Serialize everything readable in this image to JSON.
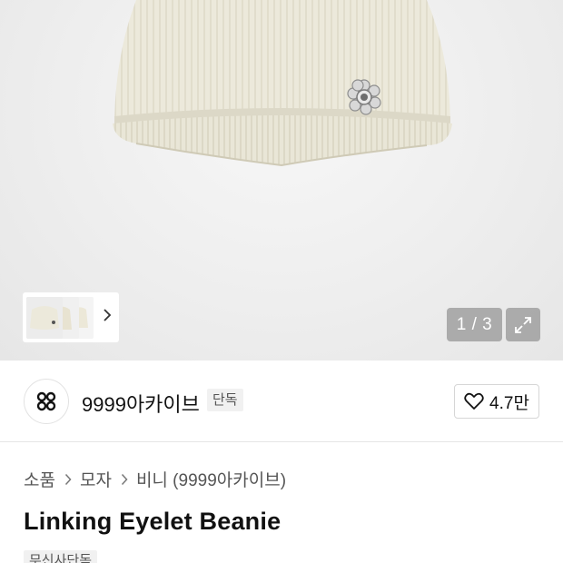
{
  "gallery": {
    "counter": "1 / 3"
  },
  "brand": {
    "name": "9999아카이브",
    "badge": "단독"
  },
  "like": {
    "count": "4.7만"
  },
  "breadcrumb": {
    "items": [
      "소품",
      "모자",
      "비니 (9999아카이브)"
    ]
  },
  "product": {
    "title": "Linking Eyelet Beanie",
    "tag": "무신사단독"
  },
  "colors": {
    "beanie": "#ece9db",
    "counter_bg": "#9a9a9a"
  },
  "icons": {
    "thumb_next": "chevron-right-icon",
    "expand": "expand-icon",
    "like": "heart-icon",
    "brand_logo": "brand-logo-icon",
    "breadcrumb_sep": "chevron-right-icon"
  }
}
